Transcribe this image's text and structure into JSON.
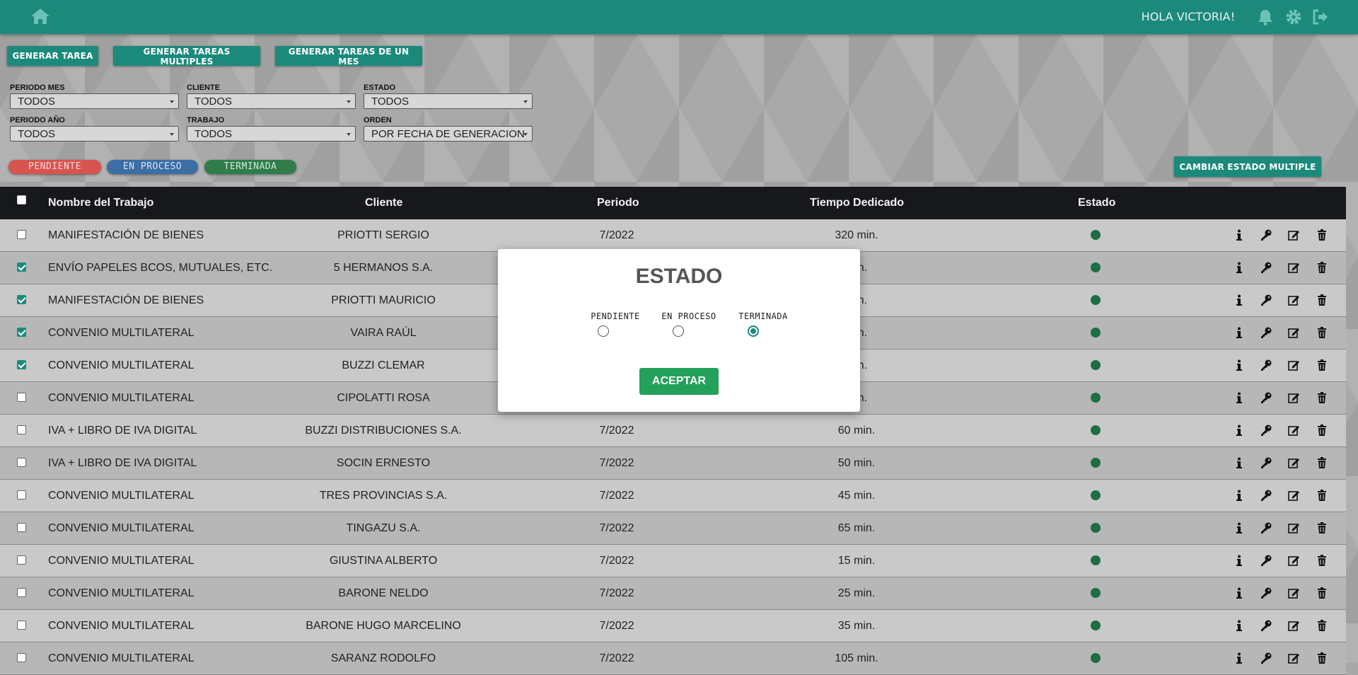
{
  "header": {
    "greeting": "HOLA VICTORIA!",
    "icons": [
      "home-icon",
      "bell-icon",
      "gear-icon",
      "logout-icon"
    ]
  },
  "actions": {
    "generar_tarea": "GENERAR TAREA",
    "generar_multiples": "GENERAR TAREAS MULTIPLES",
    "generar_mes": "GENERAR TAREAS DE UN MES",
    "cambiar_estado_multiple": "CAMBIAR ESTADO MULTIPLE"
  },
  "filters": {
    "periodo_mes": {
      "label": "PERIODO MES",
      "value": "TODOS"
    },
    "cliente": {
      "label": "CLIENTE",
      "value": "TODOS"
    },
    "estado": {
      "label": "ESTADO",
      "value": "TODOS"
    },
    "periodo_anio": {
      "label": "PERIODO AÑO",
      "value": "TODOS"
    },
    "trabajo": {
      "label": "TRABAJO",
      "value": "TODOS"
    },
    "orden": {
      "label": "ORDEN",
      "value": "POR FECHA DE GENERACION"
    }
  },
  "status_pills": {
    "pendiente": "PENDIENTE",
    "en_proceso": "EN PROCESO",
    "terminada": "TERMINADA"
  },
  "colors": {
    "brand": "#1b8a7b",
    "pendiente": "#d9534f",
    "en_proceso": "#3b6ea5",
    "terminada": "#2e7d4a",
    "status_dot": "#1e6e44",
    "accept": "#23a05a"
  },
  "table": {
    "headers": {
      "nombre": "Nombre del Trabajo",
      "cliente": "Cliente",
      "periodo": "Periodo",
      "tiempo": "Tiempo Dedicado",
      "estado": "Estado"
    },
    "rows": [
      {
        "checked": false,
        "nombre": "MANIFESTACIÓN DE BIENES",
        "cliente": "PRIOTTI SERGIO",
        "periodo": "7/2022",
        "tiempo": "320 min."
      },
      {
        "checked": true,
        "nombre": "ENVÍO PAPELES BCOS, MUTUALES, ETC.",
        "cliente": "5 HERMANOS S.A.",
        "periodo": "",
        "tiempo": "min."
      },
      {
        "checked": true,
        "nombre": "MANIFESTACIÓN DE BIENES",
        "cliente": "PRIOTTI MAURICIO",
        "periodo": "",
        "tiempo": "min."
      },
      {
        "checked": true,
        "nombre": "CONVENIO MULTILATERAL",
        "cliente": "VAIRA RAÚL",
        "periodo": "",
        "tiempo": "min."
      },
      {
        "checked": true,
        "nombre": "CONVENIO MULTILATERAL",
        "cliente": "BUZZI CLEMAR",
        "periodo": "",
        "tiempo": "min."
      },
      {
        "checked": false,
        "nombre": "CONVENIO MULTILATERAL",
        "cliente": "CIPOLATTI ROSA",
        "periodo": "",
        "tiempo": "min."
      },
      {
        "checked": false,
        "nombre": "IVA + LIBRO DE IVA DIGITAL",
        "cliente": "BUZZI DISTRIBUCIONES S.A.",
        "periodo": "7/2022",
        "tiempo": "60 min."
      },
      {
        "checked": false,
        "nombre": "IVA + LIBRO DE IVA DIGITAL",
        "cliente": "SOCIN ERNESTO",
        "periodo": "7/2022",
        "tiempo": "50 min."
      },
      {
        "checked": false,
        "nombre": "CONVENIO MULTILATERAL",
        "cliente": "TRES PROVINCIAS S.A.",
        "periodo": "7/2022",
        "tiempo": "45 min."
      },
      {
        "checked": false,
        "nombre": "CONVENIO MULTILATERAL",
        "cliente": "TINGAZU S.A.",
        "periodo": "7/2022",
        "tiempo": "65 min."
      },
      {
        "checked": false,
        "nombre": "CONVENIO MULTILATERAL",
        "cliente": "GIUSTINA ALBERTO",
        "periodo": "7/2022",
        "tiempo": "15 min."
      },
      {
        "checked": false,
        "nombre": "CONVENIO MULTILATERAL",
        "cliente": "BARONE NELDO",
        "periodo": "7/2022",
        "tiempo": "25 min."
      },
      {
        "checked": false,
        "nombre": "CONVENIO MULTILATERAL",
        "cliente": "BARONE HUGO MARCELINO",
        "periodo": "7/2022",
        "tiempo": "35 min."
      },
      {
        "checked": false,
        "nombre": "CONVENIO MULTILATERAL",
        "cliente": "SARANZ RODOLFO",
        "periodo": "7/2022",
        "tiempo": "105 min."
      }
    ]
  },
  "modal": {
    "title": "ESTADO",
    "options": [
      "PENDIENTE",
      "EN PROCESO",
      "TERMINADA"
    ],
    "selected": "TERMINADA",
    "accept_label": "ACEPTAR"
  }
}
